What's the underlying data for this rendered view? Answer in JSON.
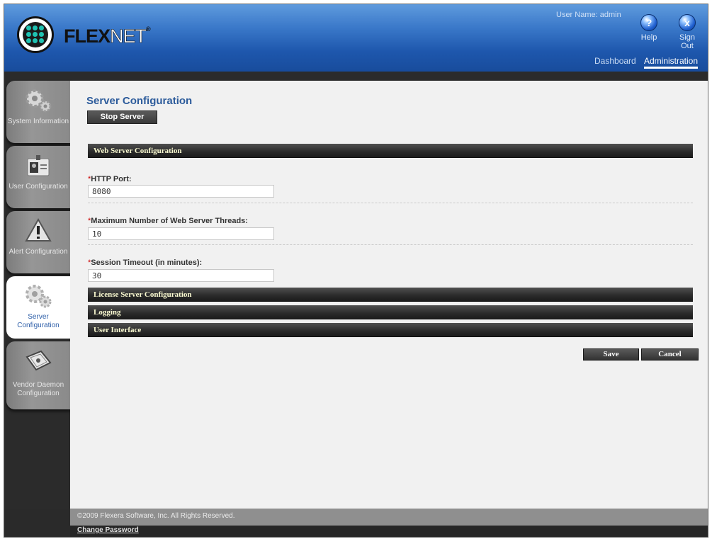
{
  "header": {
    "brand_bold": "FLEX",
    "brand_thin": "NET",
    "brand_mark": "®",
    "user_name": "User Name: admin",
    "help_label": "Help",
    "signout_label": "Sign Out",
    "nav": {
      "dashboard": "Dashboard",
      "administration": "Administration"
    },
    "accent": "#1e57ad"
  },
  "sidebar": {
    "items": [
      {
        "label": "System Information",
        "icon": "gears-icon",
        "active": false
      },
      {
        "label": "User Configuration",
        "icon": "id-badge-icon",
        "active": false
      },
      {
        "label": "Alert Configuration",
        "icon": "warning-icon",
        "active": false
      },
      {
        "label": "Server Configuration",
        "icon": "gears-icon",
        "active": true
      },
      {
        "label": "Vendor Daemon Configuration",
        "icon": "certificate-icon",
        "active": false
      }
    ]
  },
  "main": {
    "title": "Server Configuration",
    "stop_server": "Stop Server",
    "sections": {
      "web": "Web Server Configuration",
      "license": "License Server Configuration",
      "logging": "Logging",
      "ui": "User Interface"
    },
    "fields": [
      {
        "label": "HTTP Port:",
        "value": "8080",
        "required": true
      },
      {
        "label": "Maximum Number of Web Server Threads:",
        "value": "10",
        "required": true
      },
      {
        "label": "Session Timeout (in minutes):",
        "value": "30",
        "required": true
      }
    ],
    "save": "Save",
    "cancel": "Cancel"
  },
  "footer": {
    "copyright": "©2009 Flexera Software, Inc. All Rights Reserved.",
    "change_password": "Change Password"
  }
}
